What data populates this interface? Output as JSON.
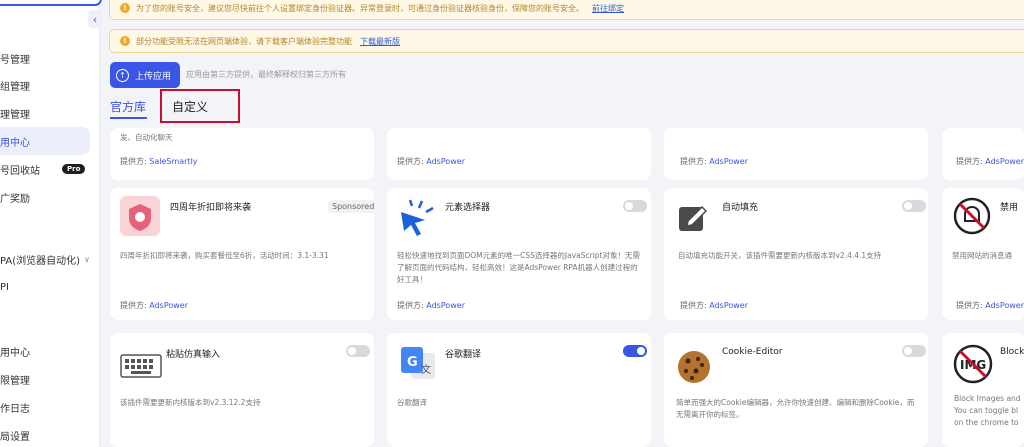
{
  "sidebar": {
    "items": [
      {
        "label": "号管理"
      },
      {
        "label": "组管理"
      },
      {
        "label": "理管理"
      },
      {
        "label": "用中心"
      },
      {
        "label": "号回收站",
        "badge": "Pro"
      },
      {
        "label": "广奖励"
      },
      {
        "label": "PA(浏览器自动化)"
      },
      {
        "label": "PI"
      },
      {
        "label": "用中心"
      },
      {
        "label": "限管理"
      },
      {
        "label": "作日志"
      },
      {
        "label": "局设置"
      }
    ]
  },
  "notices": {
    "security": "为了您的账号安全，建议您尽快前往个人设置绑定身份验证器。异常登录时，可通过身份验证器核验身份，保障您的账号安全。",
    "security_link": "前往绑定",
    "browser": "部分功能受限无法在网页端体验，请下载客户端体验完整功能",
    "browser_link": "下载最新版"
  },
  "upload": {
    "label": "上传应用",
    "hint": "应用由第三方提供，最终解释权归第三方所有"
  },
  "tabs": {
    "official": "官方库",
    "custom": "自定义"
  },
  "provider_prefix": "提供方:",
  "cards": {
    "row0": [
      {
        "desc": "发、自动化聊天",
        "provider": "SaleSmartly"
      },
      {
        "provider": "AdsPower"
      },
      {
        "provider": "AdsPower"
      },
      {
        "provider": "AdsPower"
      }
    ],
    "row1": [
      {
        "title": "四周年折扣即将来袭",
        "badge": "Sponsored",
        "desc": "四周年折扣即将来袭，购买套餐低至6折，活动时间：3.1-3.31",
        "provider": "AdsPower"
      },
      {
        "title": "元素选择器",
        "desc": "轻松快速地找到页面DOM元素的唯一CSS选择器的JavaScript对象！无需了解页面的代码结构，轻松高效！这是AdsPower RPA机器人创建过程的好工具！",
        "provider": "AdsPower"
      },
      {
        "title": "自动填充",
        "desc": "自动填充功能开关，该插件需要更新内核版本到v2.4.4.1支持",
        "provider": "AdsPower"
      },
      {
        "title": "禁用",
        "desc": "禁用网站的消息通",
        "provider": "AdsPower"
      }
    ],
    "row2": [
      {
        "title": "粘贴仿真输入",
        "desc": "该插件需要更新内核版本到v2.3.12.2支持",
        "toggle": false
      },
      {
        "title": "谷歌翻译",
        "desc": "谷歌翻译",
        "toggle": true
      },
      {
        "title": "Cookie-Editor",
        "desc": "简单而强大的Cookie编辑器，允许你快速创建、编辑和删除Cookie，而无需离开你的标签。",
        "toggle": false
      },
      {
        "title": "Block",
        "desc": "Block Images and\nYou can toggle bl\non the chrome to",
        "logo_text": "IMG"
      }
    ]
  },
  "colors": {
    "accent": "#3b55e6",
    "highlight": "#c8102e",
    "notice_bg": "#fff8e7"
  }
}
